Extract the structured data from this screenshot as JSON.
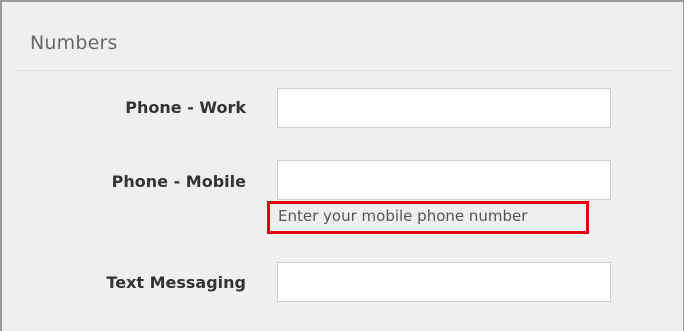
{
  "section": {
    "title": "Numbers"
  },
  "fields": [
    {
      "label": "Phone - Work",
      "value": "",
      "placeholder": ""
    },
    {
      "label": "Phone - Mobile",
      "value": "",
      "placeholder": "",
      "helper": "Enter your mobile phone number"
    },
    {
      "label": "Text Messaging",
      "value": "",
      "placeholder": ""
    }
  ],
  "highlight": {
    "color": "#e1000f"
  }
}
